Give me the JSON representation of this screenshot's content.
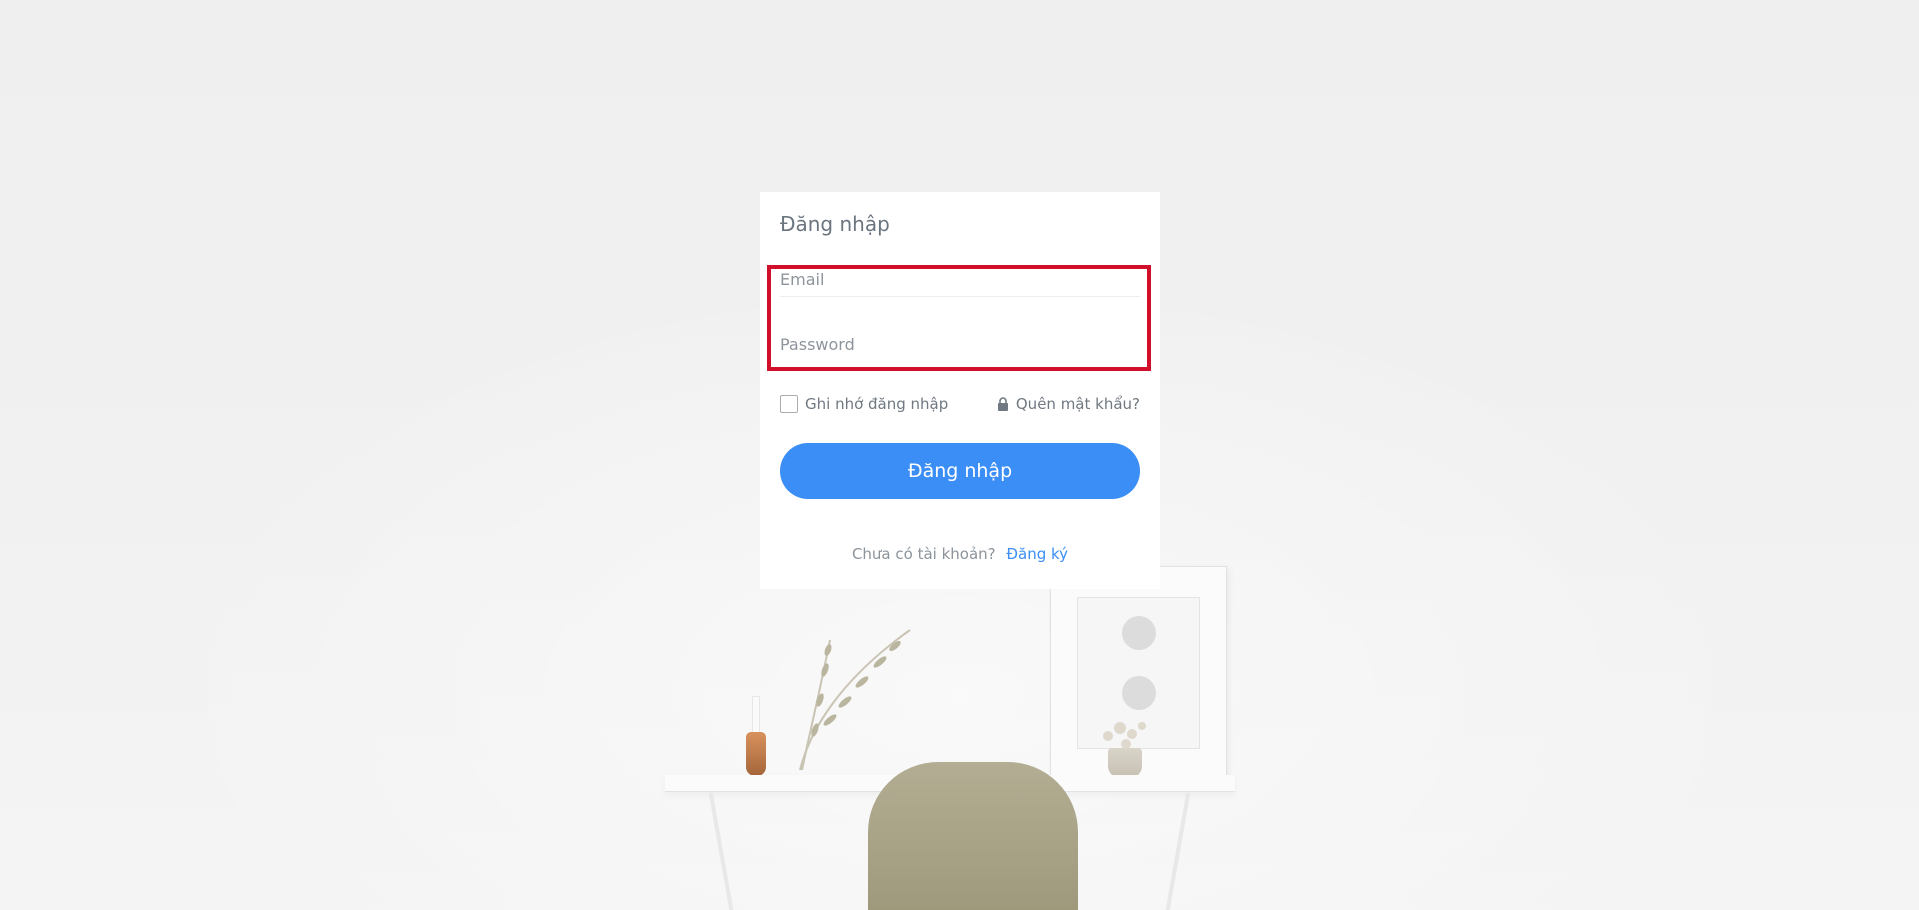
{
  "login": {
    "title": "Đăng nhập",
    "email": {
      "placeholder": "Email",
      "value": ""
    },
    "password": {
      "placeholder": "Password",
      "value": ""
    },
    "remember_label": "Ghi nhớ đăng nhập",
    "remember_checked": false,
    "forgot_label": "Quên mật khẩu?",
    "forgot_icon": "lock-icon",
    "submit_label": "Đăng nhập",
    "signup_prompt": "Chưa có tài khoản?",
    "signup_link": "Đăng ký"
  },
  "colors": {
    "primary": "#3a8ef6",
    "highlight": "#d10f2b",
    "card_background": "#ffffff",
    "page_background": "#efefef",
    "text_muted": "#707881"
  }
}
